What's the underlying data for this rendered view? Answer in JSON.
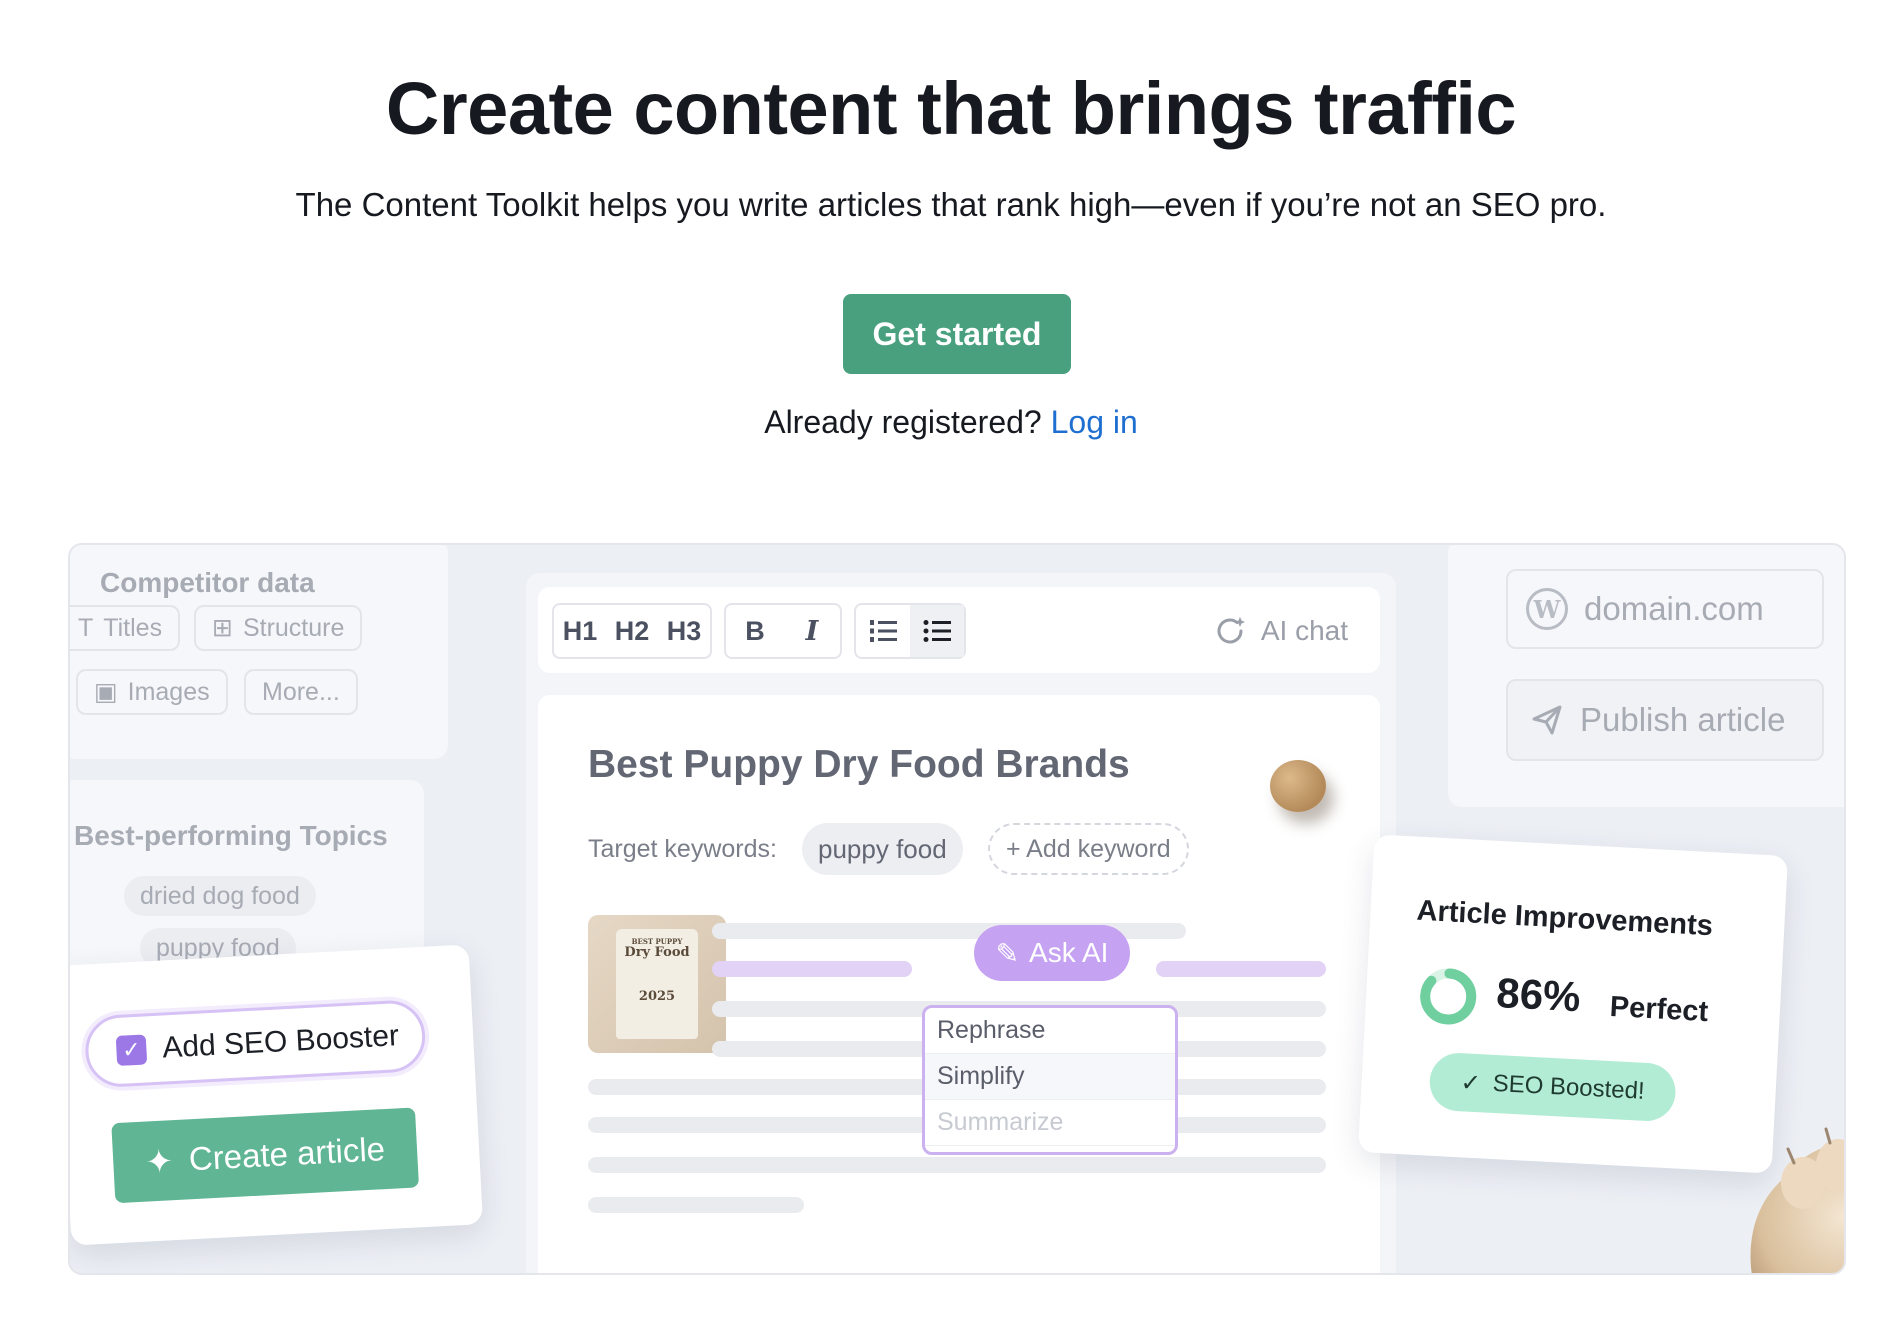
{
  "hero": {
    "title": "Create content that brings traffic",
    "subtitle": "The Content Toolkit helps you write articles that rank high—even if you’re not an SEO pro.",
    "cta_label": "Get started",
    "login_prompt": "Already registered?",
    "login_link": "Log in"
  },
  "competitor": {
    "title": "Competitor data",
    "chips": [
      "Titles",
      "Structure",
      "Images",
      "More..."
    ]
  },
  "topics": {
    "title": "Best-performing Topics",
    "tags": [
      "dried dog food",
      "puppy food"
    ]
  },
  "seo_booster": {
    "checkbox_label": "Add SEO Booster",
    "create_label": "Create article"
  },
  "editor": {
    "toolbar": {
      "headings": [
        "H1",
        "H2",
        "H3"
      ],
      "bold": "B",
      "italic": "I",
      "ai_chat": "AI chat"
    },
    "doc_title": "Best Puppy Dry Food Brands",
    "keywords_label": "Target keywords:",
    "keyword": "puppy food",
    "add_keyword": "+ Add keyword",
    "product": {
      "small": "BEST PUPPY",
      "title": "Dry Food",
      "year": "2025"
    },
    "ask_ai": "Ask AI",
    "ai_menu": [
      "Rephrase",
      "Simplify",
      "Summarize"
    ]
  },
  "publish": {
    "domain": "domain.com",
    "publish_label": "Publish article"
  },
  "improvements": {
    "title": "Article Improvements",
    "percent": "86%",
    "status_word": "Perfect",
    "score_fraction": 0.86,
    "badge": "SEO Boosted!"
  },
  "colors": {
    "cta": "#49a07f",
    "link": "#1f6fd1",
    "accent_purple": "#c6a3f2",
    "accent_green": "#b3ecd4"
  }
}
